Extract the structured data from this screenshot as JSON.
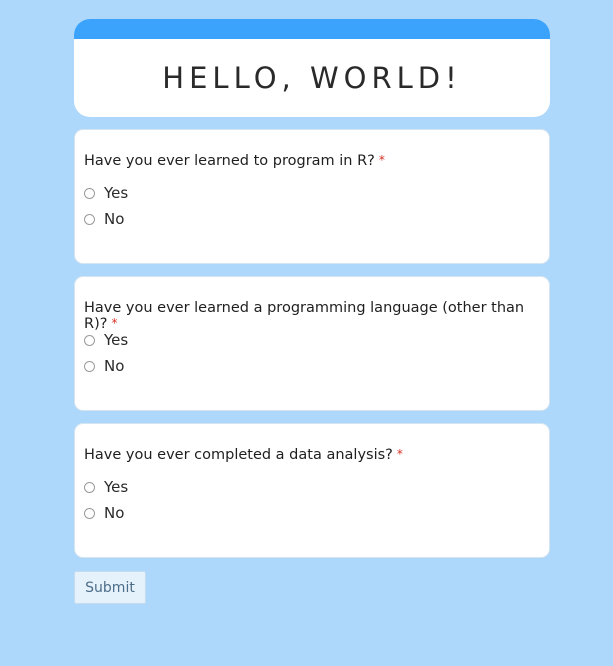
{
  "header": {
    "title": "HELLO, WORLD!",
    "accent_color": "#3ba3fb",
    "background_color": "#add8fb"
  },
  "questions": [
    {
      "text": "Have you ever learned to program in R?",
      "required_mark": "*",
      "options": [
        "Yes",
        "No"
      ]
    },
    {
      "text": "Have you ever learned a programming language (other than R)?",
      "required_mark": "*",
      "options": [
        "Yes",
        "No"
      ]
    },
    {
      "text": "Have you ever completed a data analysis?",
      "required_mark": "*",
      "options": [
        "Yes",
        "No"
      ]
    }
  ],
  "submit": {
    "label": "Submit"
  }
}
